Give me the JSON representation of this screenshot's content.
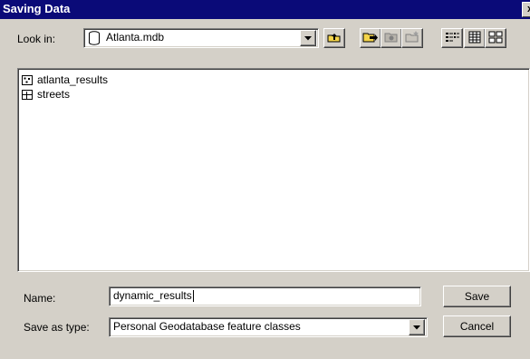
{
  "window": {
    "title": "Saving Data",
    "close_glyph": "x"
  },
  "look_in": {
    "label": "Look in:",
    "value": "Atlanta.mdb",
    "icon": "database-icon"
  },
  "toolbar": {
    "buttons": [
      "up-one-level-icon",
      "connect-folder-icon",
      "disconnect-folder-icon",
      "new-folder-icon",
      "list-view-icon",
      "details-view-icon",
      "thumbnails-view-icon"
    ]
  },
  "file_list": {
    "items": [
      {
        "name": "atlanta_results",
        "icon": "point-featureclass-icon"
      },
      {
        "name": "streets",
        "icon": "line-featureclass-icon"
      }
    ]
  },
  "name_field": {
    "label": "Name:",
    "value": "dynamic_results"
  },
  "save_type": {
    "label": "Save as type:",
    "value": "Personal Geodatabase feature classes"
  },
  "buttons": {
    "save": "Save",
    "cancel": "Cancel"
  }
}
